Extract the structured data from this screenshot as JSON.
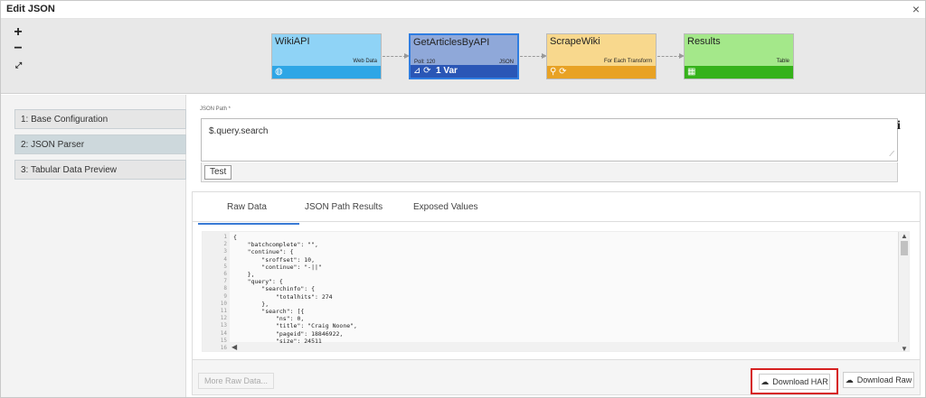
{
  "window": {
    "title": "Edit JSON",
    "close": "×"
  },
  "zoom": {
    "in": "+",
    "out": "−",
    "fit": "⤢"
  },
  "nodes": [
    {
      "name": "WikiAPI",
      "type": "Web Data",
      "poll": "",
      "var": "",
      "color": "#8fd3f6",
      "bar_color": "#2ea6e6"
    },
    {
      "name": "GetArticlesByAPI",
      "type": "JSON",
      "poll": "Poll: 120",
      "var": "1 Var",
      "color": "#8fa8d9",
      "bar_color": "#2a56b6"
    },
    {
      "name": "ScrapeWiki",
      "type": "For Each Transform",
      "poll": "",
      "var": "",
      "color": "#f8d88d",
      "bar_color": "#e8a224"
    },
    {
      "name": "Results",
      "type": "Table",
      "poll": "",
      "var": "",
      "color": "#a4e88a",
      "bar_color": "#35b21a"
    }
  ],
  "steps": [
    {
      "label": "1: Base Configuration"
    },
    {
      "label": "2: JSON Parser"
    },
    {
      "label": "3: Tabular Data Preview"
    }
  ],
  "json_path": {
    "label": "JSON Path *",
    "value": "$.query.search",
    "test": "Test",
    "info": "i"
  },
  "tabs": [
    {
      "label": "Raw Data"
    },
    {
      "label": "JSON Path Results"
    },
    {
      "label": "Exposed Values"
    }
  ],
  "code": {
    "line_numbers": [
      "1",
      "2",
      "3",
      "4",
      "5",
      "6",
      "7",
      "8",
      "9",
      "10",
      "11",
      "12",
      "13",
      "14",
      "15",
      "16"
    ],
    "lines": [
      "{",
      "    \"batchcomplete\": \"\",",
      "    \"continue\": {",
      "        \"sroffset\": 10,",
      "        \"continue\": \"-||\"",
      "    },",
      "    \"query\": {",
      "        \"searchinfo\": {",
      "            \"totalhits\": 274",
      "        },",
      "        \"search\": [{",
      "            \"ns\": 0,",
      "            \"title\": \"Craig Noone\",",
      "            \"pageid\": 18846922,",
      "            \"size\": 24511",
      ""
    ]
  },
  "footer": {
    "more": "More Raw Data...",
    "download_har": "Download HAR",
    "download_raw": "Download Raw"
  }
}
